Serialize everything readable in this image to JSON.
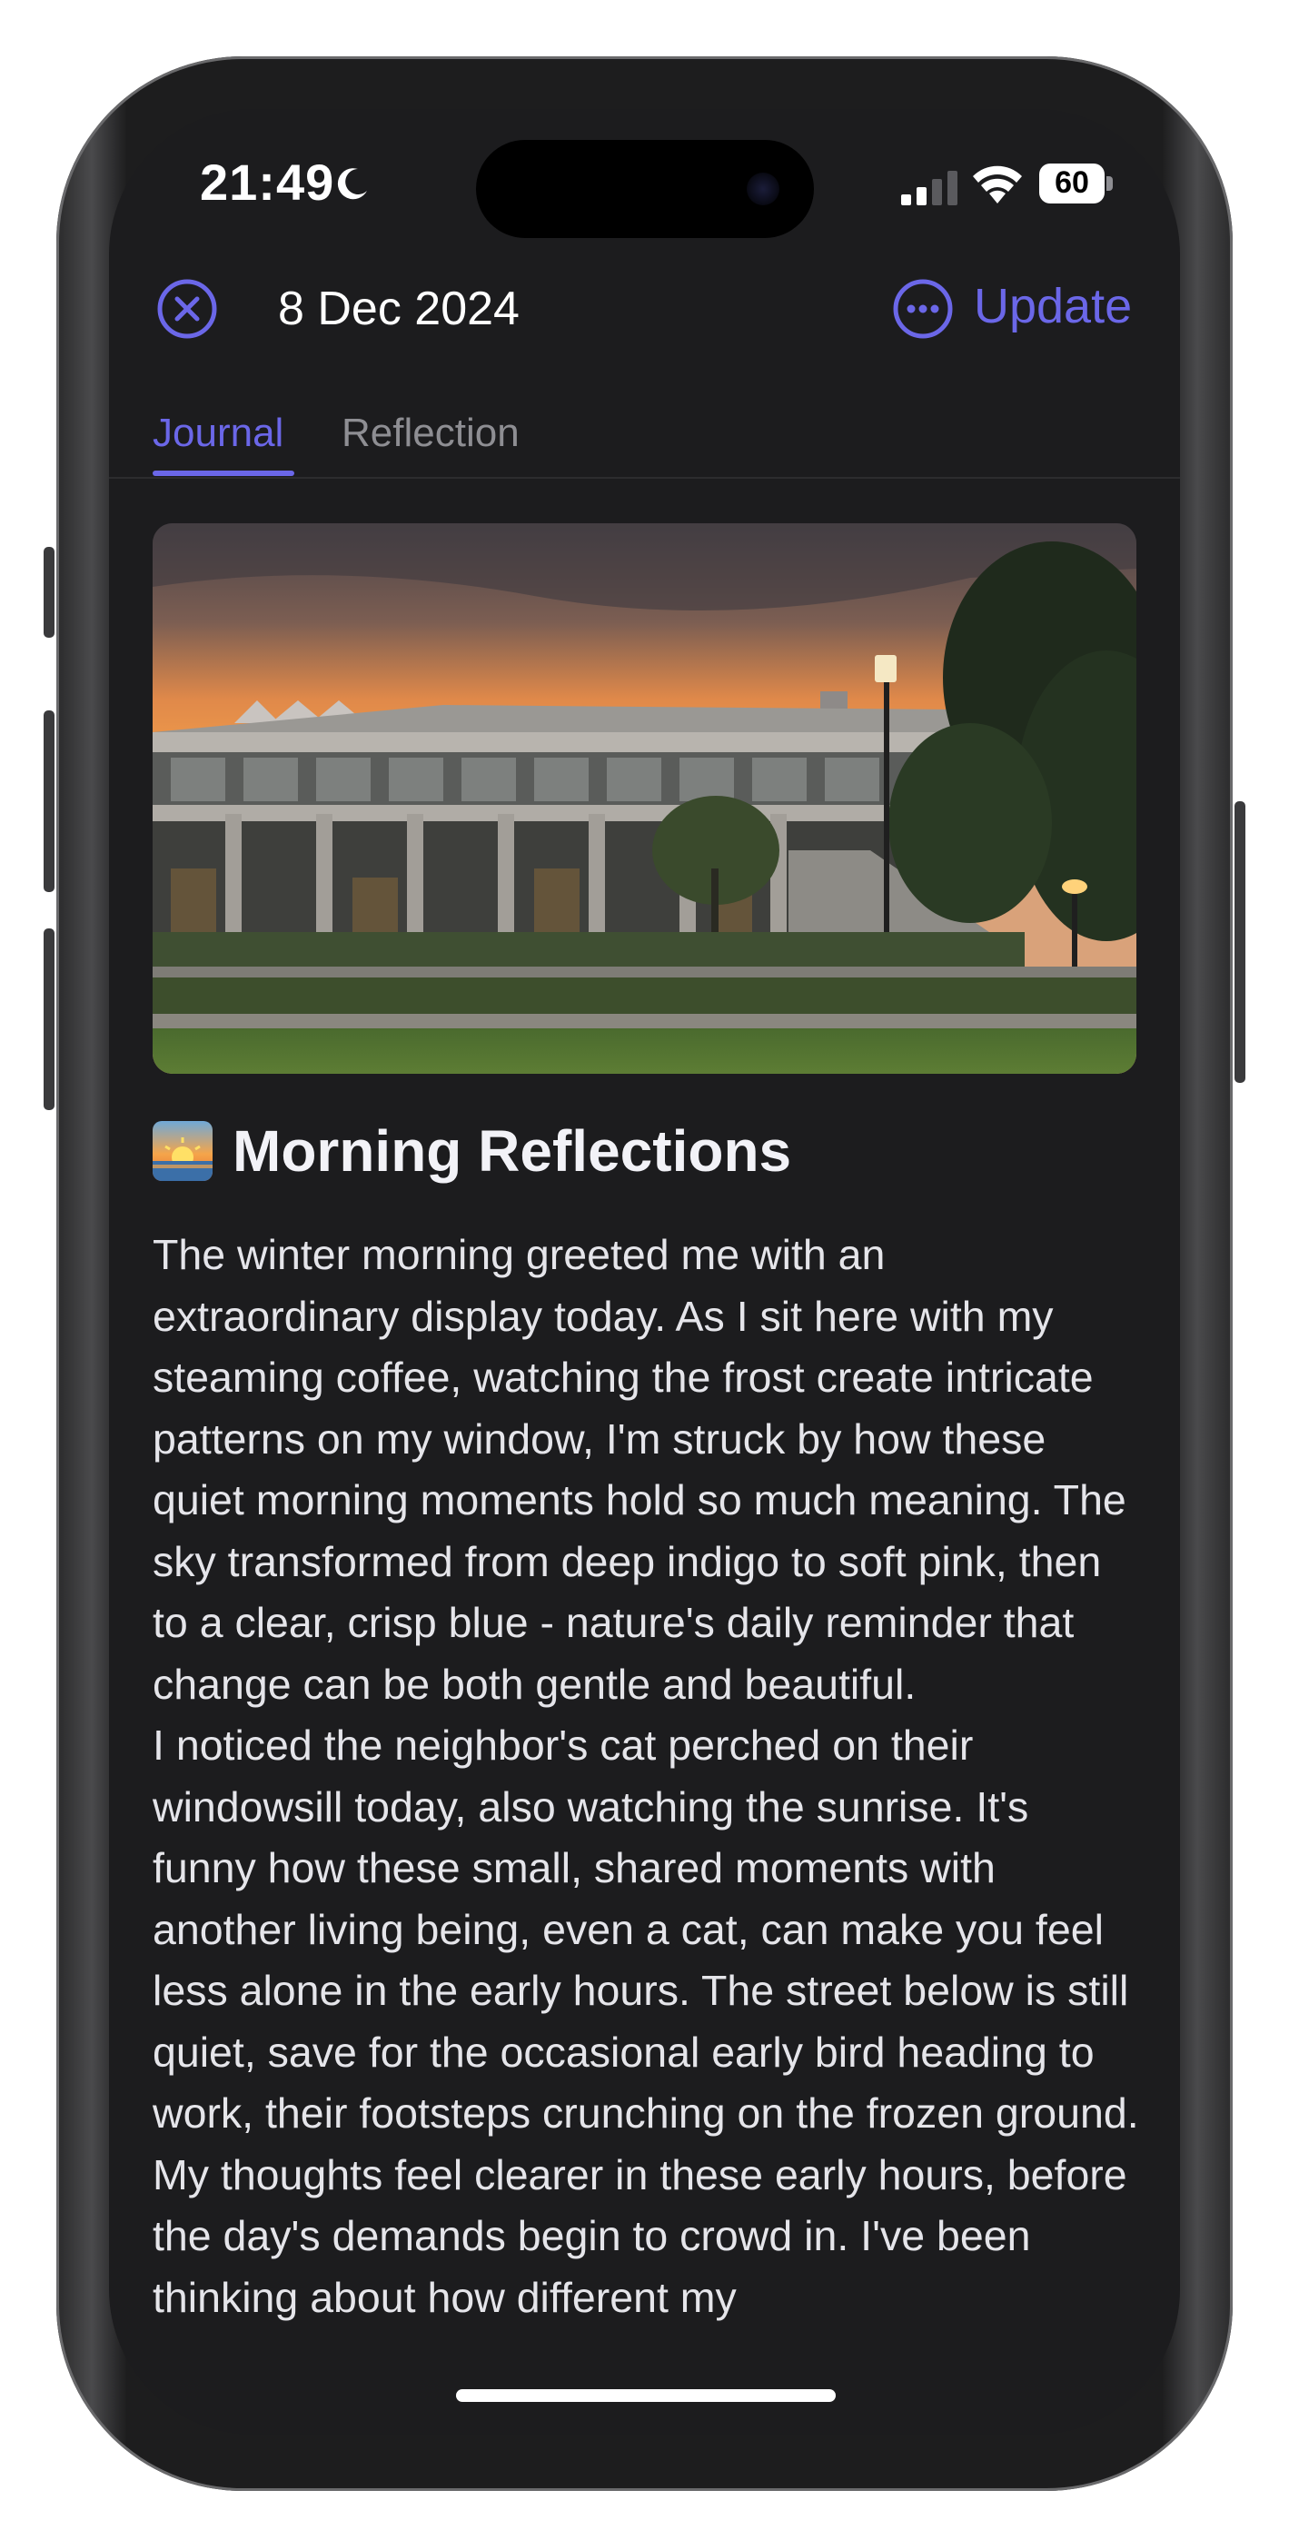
{
  "status_bar": {
    "time": "21:49",
    "battery": "60",
    "icons": [
      "moon-icon",
      "signal-icon",
      "wifi-icon",
      "battery-icon"
    ]
  },
  "header": {
    "close_icon": "close-icon",
    "date": "8 Dec 2024",
    "more_icon": "more-icon",
    "update_label": "Update"
  },
  "tabs": [
    {
      "label": "Journal",
      "active": true
    },
    {
      "label": "Reflection",
      "active": false
    }
  ],
  "entry": {
    "heading_icon": "sunrise-icon",
    "title": "Morning Reflections",
    "paragraphs": [
      "The winter morning greeted me with an extraordinary display today. As I sit here with my steaming coffee, watching the frost create intricate patterns on my window, I'm struck by how these quiet morning moments hold so much meaning. The sky transformed from deep indigo to soft pink, then to a clear, crisp blue - nature's daily reminder that change can be both gentle and beautiful.",
      "I noticed the neighbor's cat perched on their windowsill today, also watching the sunrise. It's funny how these small, shared moments with another living being, even a cat, can make you feel less alone in the early hours. The street below is still quiet, save for the occasional early bird heading to work, their footsteps crunching on the frozen ground.",
      "My thoughts feel clearer in these early hours, before the day's demands begin to crowd in. I've been thinking about how different my"
    ]
  },
  "colors": {
    "accent": "#6b67e8",
    "background": "#1c1c1e",
    "text": "#e5e5ea",
    "inactive_tab": "#8e8e93"
  }
}
